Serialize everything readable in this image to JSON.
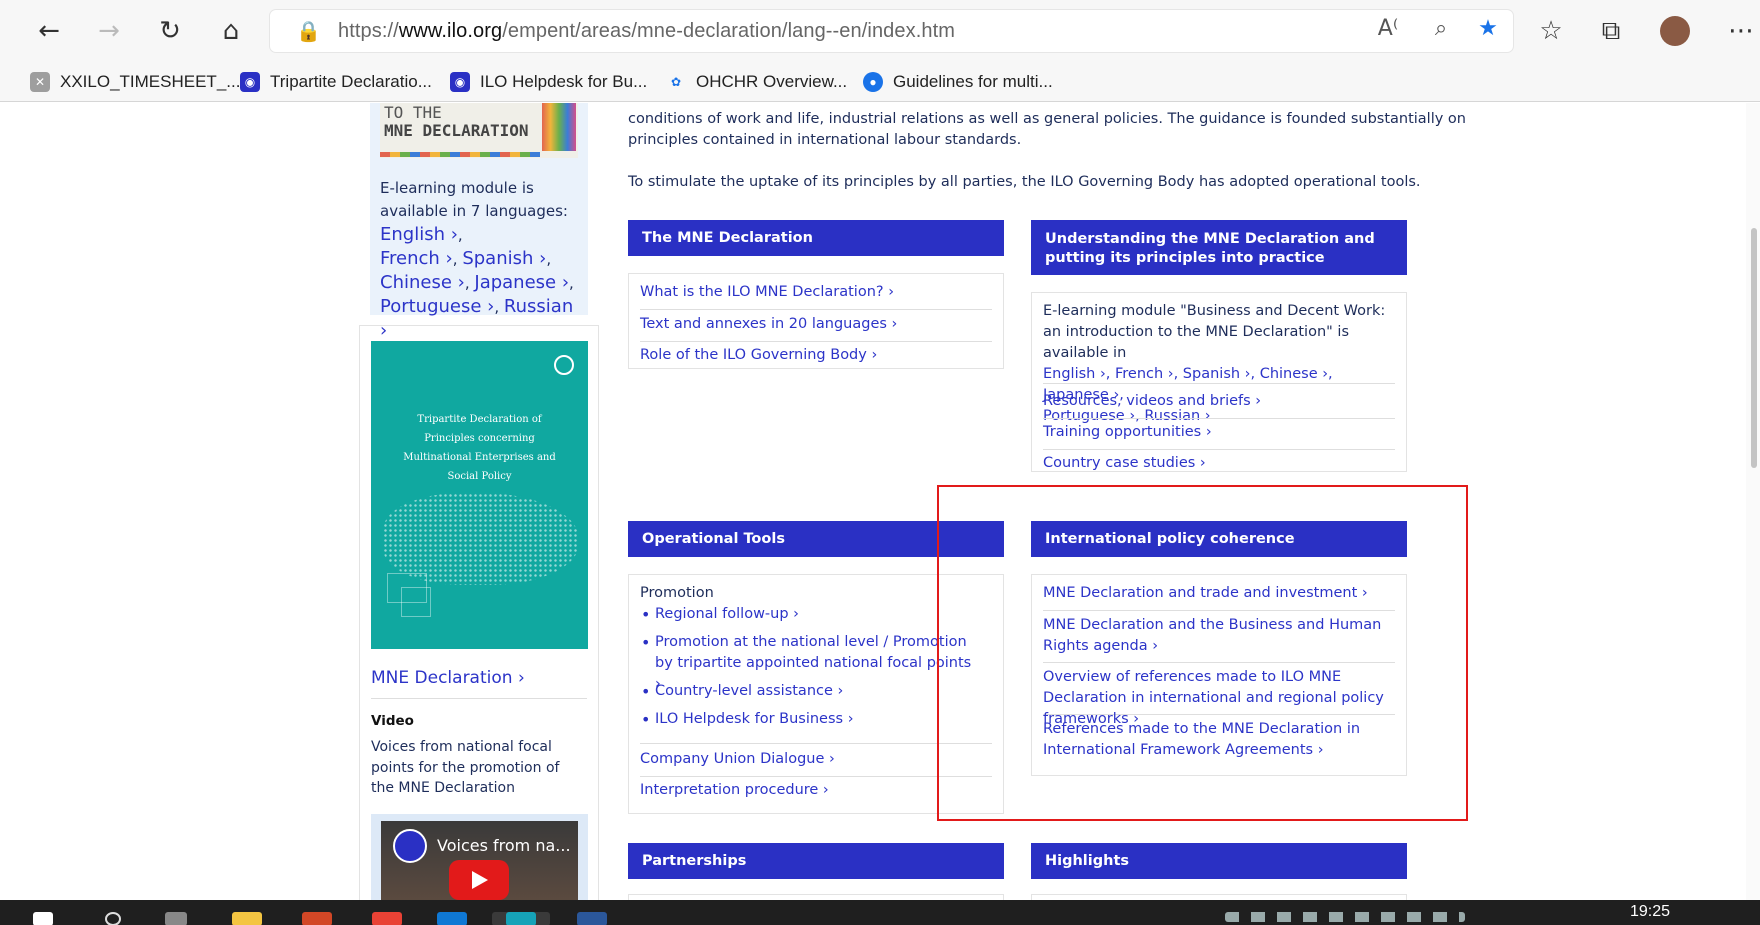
{
  "browser": {
    "url_scheme": "https://",
    "url_host": "www.ilo.org",
    "url_path": "/empent/areas/mne-declaration/lang--en/index.htm",
    "favorites": [
      {
        "label": "XXILO_TIMESHEET_..."
      },
      {
        "label": "Tripartite Declaratio..."
      },
      {
        "label": "ILO Helpdesk for Bu..."
      },
      {
        "label": "OHCHR  Overview..."
      },
      {
        "label": "Guidelines for multi..."
      }
    ]
  },
  "sidebar": {
    "cover_line1": "TO THE",
    "cover_line2": "MNE DECLARATION",
    "elearning_text": "E-learning module is available in 7 languages:",
    "lang_links": [
      "English ›",
      "French ›",
      "Spanish ›",
      "Chinese ›",
      "Japanese ›",
      "Portuguese ›",
      "Russian ›"
    ],
    "book_title": "Tripartite Declaration of Principles concerning Multinational Enterprises and Social Policy",
    "mne_link": "MNE Declaration ›",
    "video_label": "Video",
    "video_desc": "Voices from national focal points for the promotion of the MNE Declaration",
    "video_title": "Voices from na..."
  },
  "intro": {
    "line1": "conditions of work and life, industrial relations as well as general policies. The guidance is founded substantially on",
    "line2": "principles contained in international labour standards.",
    "line3": "To stimulate the uptake of its principles by all parties, the ILO Governing Body has adopted operational tools."
  },
  "boxes": {
    "mne": {
      "title": "The MNE Declaration",
      "links": [
        "What is the ILO MNE Declaration? ›",
        "Text and annexes in 20 languages ›",
        "Role of the ILO Governing Body ›"
      ]
    },
    "understanding": {
      "title": "Understanding the MNE Declaration and putting its principles into practice",
      "elearning": "E-learning module \"Business and Decent Work: an introduction to the MNE Declaration\" is available in",
      "langs1": "English ›, French ›, Spanish ›, Chinese ›, Japanese ›,",
      "langs2": "Portuguese ›, Russian ›",
      "links": [
        "Resources, videos and briefs ›",
        "Training opportunities ›",
        "Country case studies ›"
      ]
    },
    "operational": {
      "title": "Operational Tools",
      "promotion": "Promotion",
      "bullets": [
        "Regional follow-up ›",
        "Promotion at the national level / Promotion by tripartite appointed national focal points ›",
        "Country-level assistance ›",
        "ILO Helpdesk for Business ›"
      ],
      "links": [
        "Company Union Dialogue ›",
        "Interpretation procedure ›"
      ]
    },
    "coherence": {
      "title": "International policy coherence",
      "links": [
        "MNE Declaration and trade and investment ›",
        "MNE Declaration and the Business and Human Rights agenda ›",
        "Overview of references made to ILO MNE Declaration in international and regional policy frameworks ›",
        "References made to the MNE Declaration in International Framework Agreements ›"
      ]
    },
    "partnerships": {
      "title": "Partnerships"
    },
    "highlights": {
      "title": "Highlights"
    }
  },
  "taskbar": {
    "time": "19:25"
  },
  "colors": {
    "accent": "#2a30c4",
    "link": "#2c34c8",
    "annotation": "#e21a1a",
    "teal_cover": "#10a8a0"
  }
}
